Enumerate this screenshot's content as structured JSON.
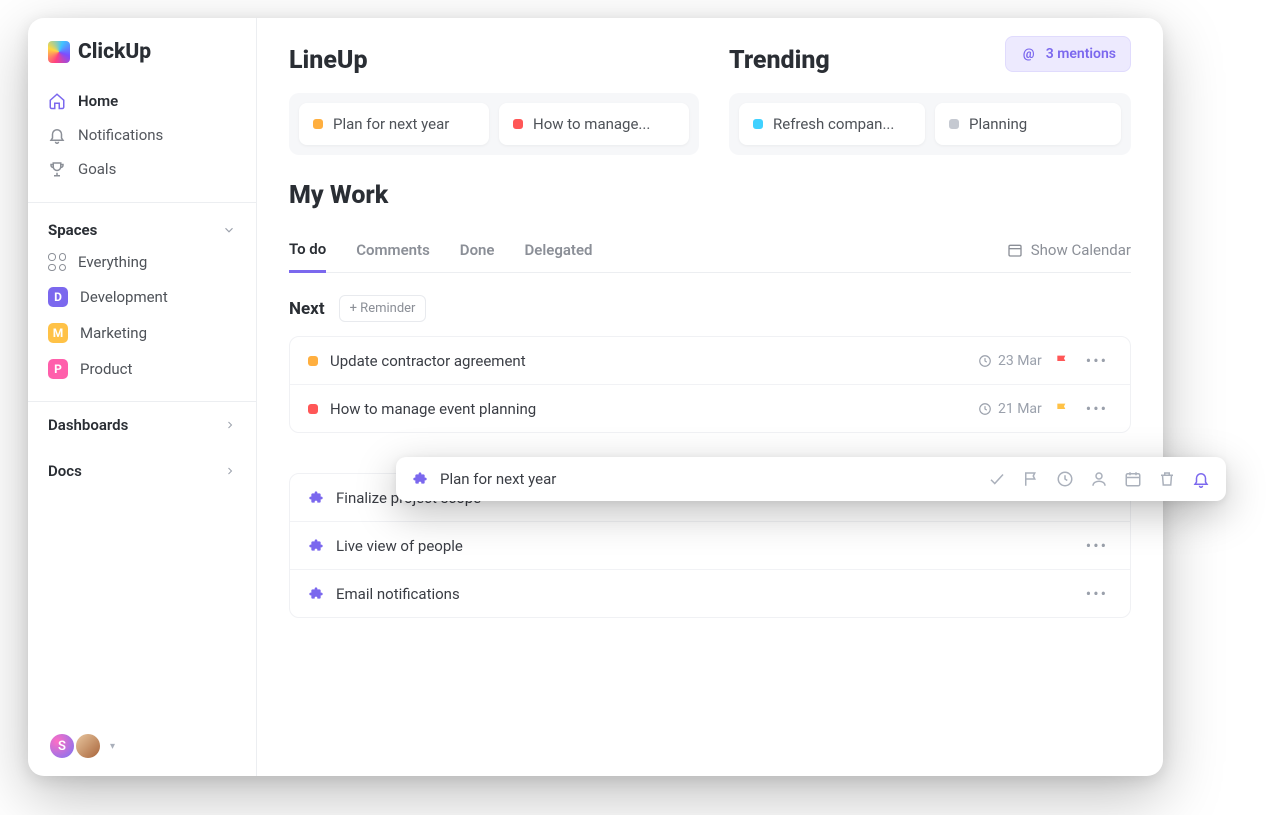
{
  "app": {
    "name": "ClickUp"
  },
  "sidebar": {
    "nav": [
      {
        "label": "Home",
        "icon": "home",
        "active": true
      },
      {
        "label": "Notifications",
        "icon": "bell",
        "active": false
      },
      {
        "label": "Goals",
        "icon": "trophy",
        "active": false
      }
    ],
    "spaces_header": "Spaces",
    "everything_label": "Everything",
    "spaces": [
      {
        "initial": "D",
        "label": "Development",
        "cls": "sp-dev"
      },
      {
        "initial": "M",
        "label": "Marketing",
        "cls": "sp-mkt"
      },
      {
        "initial": "P",
        "label": "Product",
        "cls": "sp-prd"
      }
    ],
    "links": [
      {
        "label": "Dashboards"
      },
      {
        "label": "Docs"
      }
    ],
    "avatar_initial": "S"
  },
  "main": {
    "lineup_heading": "LineUp",
    "trending_heading": "Trending",
    "mentions_label": "3 mentions",
    "lineup_cards": [
      {
        "label": "Plan for next year",
        "dot": "d-orange"
      },
      {
        "label": "How to manage...",
        "dot": "d-red"
      }
    ],
    "trending_cards": [
      {
        "label": "Refresh compan...",
        "dot": "d-cyan"
      },
      {
        "label": "Planning",
        "dot": "d-gray"
      }
    ],
    "my_work_heading": "My Work",
    "tabs": [
      {
        "label": "To do",
        "active": true
      },
      {
        "label": "Comments",
        "active": false
      },
      {
        "label": "Done",
        "active": false
      },
      {
        "label": "Delegated",
        "active": false
      }
    ],
    "show_calendar_label": "Show Calendar",
    "next_label": "Next",
    "reminder_chip": "+ Reminder",
    "tasks_primary": [
      {
        "title": "Update contractor agreement",
        "date": "23 Mar",
        "dot": "d-orange",
        "flag": "f-red"
      },
      {
        "title": "How to manage event planning",
        "date": "21 Mar",
        "dot": "d-red",
        "flag": "f-yellow"
      }
    ],
    "tasks_secondary": [
      {
        "title": "Finalize project scope"
      },
      {
        "title": "Live view of people"
      },
      {
        "title": "Email notifications"
      }
    ]
  },
  "popup": {
    "title": "Plan for next year"
  }
}
